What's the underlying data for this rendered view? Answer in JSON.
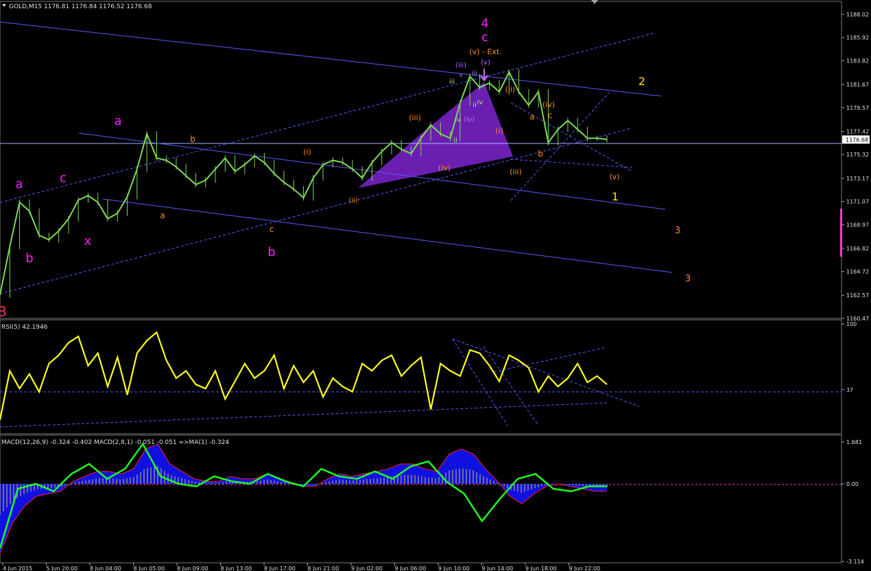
{
  "window": {
    "symbol_label": "GOLD,M15",
    "ohlc_label": "1176.81 1176.84 1176.52 1176.68"
  },
  "colors": {
    "background": "#000000",
    "candle_up": "#7ed957",
    "channel": "#5a5aff",
    "price_line": "#a8b4ff",
    "rsi_line": "#ffff1e",
    "macd_hist": "#1010e0",
    "macd_line": "#1eff1e",
    "signal": "#ff2020",
    "wave_pink": "#ff1eff",
    "wave_orange": "#ff8c1e",
    "wave_yellow": "#ffe01e",
    "wedge": "#6b1fb1"
  },
  "chart_data": [
    {
      "type": "line",
      "name": "price-pane",
      "current_price": 1176.68,
      "ylim": [
        1160.47,
        1189.2
      ],
      "y_ticks": [
        "1188.02",
        "1185.92",
        "1183.82",
        "1181.67",
        "1179.57",
        "1177.42",
        "1175.32",
        "1173.17",
        "1171.07",
        "1168.97",
        "1166.82",
        "1164.72",
        "1162.57",
        "1160.47"
      ],
      "x_tick_labels": [
        "4 Jun 2015",
        "5 Jun 20:00",
        "8 Jun 04:00",
        "8 Jun 05:00",
        "8 Jun 09:00",
        "8 Jun 13:00",
        "8 Jun 17:00",
        "8 Jun 21:00",
        "9 Jun 02:00",
        "9 Jun 06:00",
        "9 Jun 10:00",
        "9 Jun 14:00",
        "9 Jun 18:00",
        "9 Jun 22:00"
      ],
      "series": [
        {
          "values": [
            1162.6,
            1167.0,
            1171.0,
            1170.2,
            1168.0,
            1167.6,
            1168.4,
            1169.5,
            1171.2,
            1171.6,
            1171.0,
            1169.5,
            1170.0,
            1171.5,
            1174.0,
            1177.2,
            1175.0,
            1174.8,
            1174.2,
            1173.4,
            1172.6,
            1173.0,
            1174.0,
            1175.0,
            1173.8,
            1174.4,
            1175.2,
            1174.6,
            1173.6,
            1172.8,
            1172.2,
            1171.4,
            1173.2,
            1174.4,
            1174.8,
            1174.6,
            1174.0,
            1173.2,
            1174.6,
            1175.6,
            1176.4,
            1175.8,
            1175.4,
            1176.8,
            1178.0,
            1177.2,
            1176.8,
            1180.0,
            1182.4,
            1181.4,
            1181.8,
            1181.0,
            1182.8,
            1181.0,
            1179.8,
            1181.0,
            1176.4,
            1177.6,
            1178.4,
            1177.6,
            1176.8,
            1176.8,
            1176.68
          ]
        }
      ],
      "wave_labels": [
        "4",
        "c",
        "(v) - Ext.",
        "a",
        "c",
        "b",
        "x",
        "a",
        "b",
        "c",
        "b",
        "a",
        "(i)",
        "(ii)",
        "(iii)",
        "(iv)",
        "(iii)",
        "v",
        "iii",
        "(v)",
        "iii",
        "ii",
        "iv",
        "iv",
        "(iv)",
        "ii",
        "(ii)",
        "(i)",
        "(iii)",
        "a",
        "(iv)",
        "c",
        "b",
        "(v)",
        "2",
        "1",
        "3",
        "3",
        "B"
      ]
    },
    {
      "type": "line",
      "name": "rsi-pane",
      "title": "RSI(5) 42.1946",
      "ylim": [
        0,
        100
      ],
      "y_ticks": [
        "100",
        "37"
      ],
      "series": [
        {
          "values": [
            8,
            55,
            38,
            52,
            35,
            62,
            70,
            82,
            88,
            60,
            72,
            40,
            68,
            32,
            72,
            84,
            92,
            65,
            48,
            55,
            42,
            38,
            55,
            28,
            45,
            62,
            48,
            55,
            70,
            38,
            60,
            44,
            55,
            30,
            48,
            40,
            35,
            62,
            55,
            65,
            70,
            50,
            60,
            68,
            18,
            62,
            55,
            50,
            75,
            72,
            60,
            45,
            70,
            65,
            58,
            35,
            50,
            40,
            48,
            62,
            44,
            50,
            42
          ]
        }
      ]
    },
    {
      "type": "bar",
      "name": "macd-pane",
      "title": "MACD(12,26,9) -0.324 -0.402  MACD(2,8,1) -0.051 -0.051  =>MA(1) -0.324",
      "ylim": [
        -3.114,
        1.681
      ],
      "y_ticks": [
        "1.681",
        "0.00",
        "-3.114"
      ],
      "series": [
        {
          "name": "MACD(12,26,9)",
          "values": [
            -2.8,
            -1.6,
            -0.9,
            -0.5,
            -0.4,
            -0.3,
            0.1,
            0.3,
            0.5,
            0.5,
            0.4,
            0.6,
            1.4,
            1.6,
            0.8,
            0.5,
            0.2,
            0.1,
            0.1,
            0.3,
            0.2,
            0.2,
            0.4,
            0.2,
            0.0,
            -0.1,
            -0.1,
            0.2,
            0.4,
            0.3,
            0.4,
            0.5,
            0.6,
            0.8,
            0.8,
            0.6,
            0.5,
            1.2,
            1.4,
            1.2,
            0.6,
            0.1,
            -0.5,
            -0.8,
            -0.4,
            -0.1,
            0.0,
            -0.1,
            -0.2,
            -0.3,
            -0.3
          ]
        },
        {
          "name": "MACD(2,8,1)",
          "values": [
            -2.6,
            -0.2,
            0.0,
            -0.3,
            0.4,
            0.8,
            0.2,
            0.6,
            1.6,
            0.3,
            0.0,
            -0.1,
            0.3,
            0.1,
            0.0,
            0.4,
            0.1,
            -0.1,
            0.6,
            0.3,
            0.2,
            0.5,
            0.2,
            0.7,
            0.9,
            0.1,
            -0.4,
            -1.5,
            -0.6,
            0.2,
            0.4,
            -0.2,
            -0.3,
            -0.1,
            -0.1
          ]
        }
      ]
    }
  ]
}
